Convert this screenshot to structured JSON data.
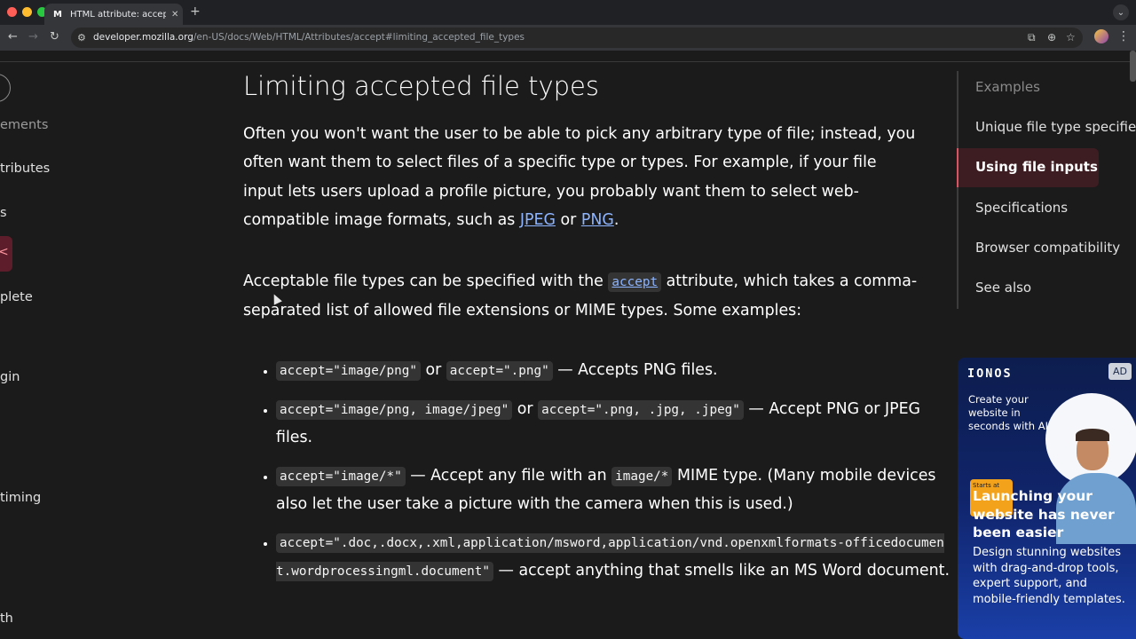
{
  "browser": {
    "tab_title": "HTML attribute: accept - HTML",
    "tab_favicon": "M",
    "url_host": "developer.mozilla.org",
    "url_path": "/en-US/docs/Web/HTML/Attributes/accept#limiting_accepted_file_types",
    "icons": [
      "back-icon",
      "forward-icon",
      "reload-icon",
      "site-settings-icon",
      "cast-icon",
      "zoom-icon",
      "bookmark-star-icon",
      "profile-icon",
      "menu-kebab-icon"
    ]
  },
  "sidebar": {
    "items": [
      "ements",
      "tributes",
      "s",
      "plete",
      "gin",
      "timing",
      "th"
    ],
    "active_marker": "<"
  },
  "main": {
    "heading": "Limiting accepted file types",
    "para1": {
      "text": "Often you won't want the user to be able to pick any arbitrary type of file; instead, you often want them to select files of a specific type or types. For example, if your file input lets users upload a profile picture, you probably want them to select web-compatible image formats, such as",
      "link1": "JPEG",
      "between": "or",
      "link2": "PNG",
      "end": "."
    },
    "para2": {
      "before": "Acceptable file types can be specified with the",
      "code": "accept",
      "after": "attribute, which takes a comma-separated list of allowed file extensions or MIME types. Some examples:"
    },
    "examples": [
      {
        "code1": "accept=\"image/png\"",
        "mid": "or",
        "code2": "accept=\".png\"",
        "text": "— Accepts PNG files."
      },
      {
        "code1": "accept=\"image/png, image/jpeg\"",
        "mid": "or",
        "code2": "accept=\".png, .jpg, .jpeg\"",
        "text": "— Accept PNG or JPEG files."
      },
      {
        "code1": "accept=\"image/*\"",
        "mid": "— Accept any file with an",
        "code2": "image/*",
        "text": "MIME type. (Many mobile devices also let the user take a picture with the camera when this is used.)"
      },
      {
        "code1": "accept=\".doc,.docx,.xml,application/msword,application/vnd.openxmlformats-officedocument.wordprocessingml.document\"",
        "text": "— accept anything that smells like an MS Word document."
      }
    ]
  },
  "toc": {
    "items": [
      "Examples",
      "Unique file type specifiers",
      "Using file inputs",
      "Specifications",
      "Browser compatibility",
      "See also"
    ],
    "active": "Using file inputs"
  },
  "ad": {
    "logo": "IONOS",
    "badge": "AD",
    "tagline": "Create your website in seconds with AI",
    "cta": "Starts at",
    "headline": "Launching your website has never been easier",
    "desc": "Design stunning websites with drag-and-drop tools, expert support, and mobile-friendly templates."
  },
  "colors": {
    "page_bg": "#1b1b1b",
    "link": "#8cb4ff",
    "toc_active_accent": "#d75463",
    "ad_bg": "#10246a",
    "ad_cta": "#f3a21b"
  }
}
